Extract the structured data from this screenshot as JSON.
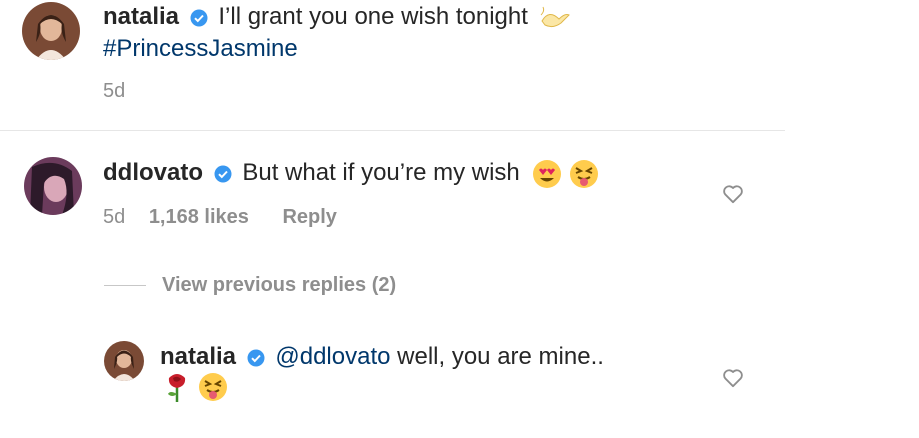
{
  "post": {
    "username": "natalia",
    "caption": "I’ll grant you one wish tonight",
    "hashtag": "#PrincessJasmine",
    "time": "5d"
  },
  "comment": {
    "username": "ddlovato",
    "text": "But what if you’re my wish",
    "time": "5d",
    "likes": "1,168 likes",
    "reply_label": "Reply"
  },
  "view_previous": "View previous replies (2)",
  "reply": {
    "username": "natalia",
    "mention": "@ddlovato",
    "text": "well, you are mine.."
  },
  "icons": {
    "verified": "verified-badge-icon",
    "heart": "heart-outline-icon",
    "lamp": "magic-lamp-icon",
    "heart_eyes": "heart-eyes-emoji-icon",
    "tongue": "squinting-tongue-emoji-icon",
    "rose": "rose-emoji-icon"
  },
  "colors": {
    "verified": "#3897f0",
    "link": "#00376b",
    "muted": "#8e8e8e"
  }
}
